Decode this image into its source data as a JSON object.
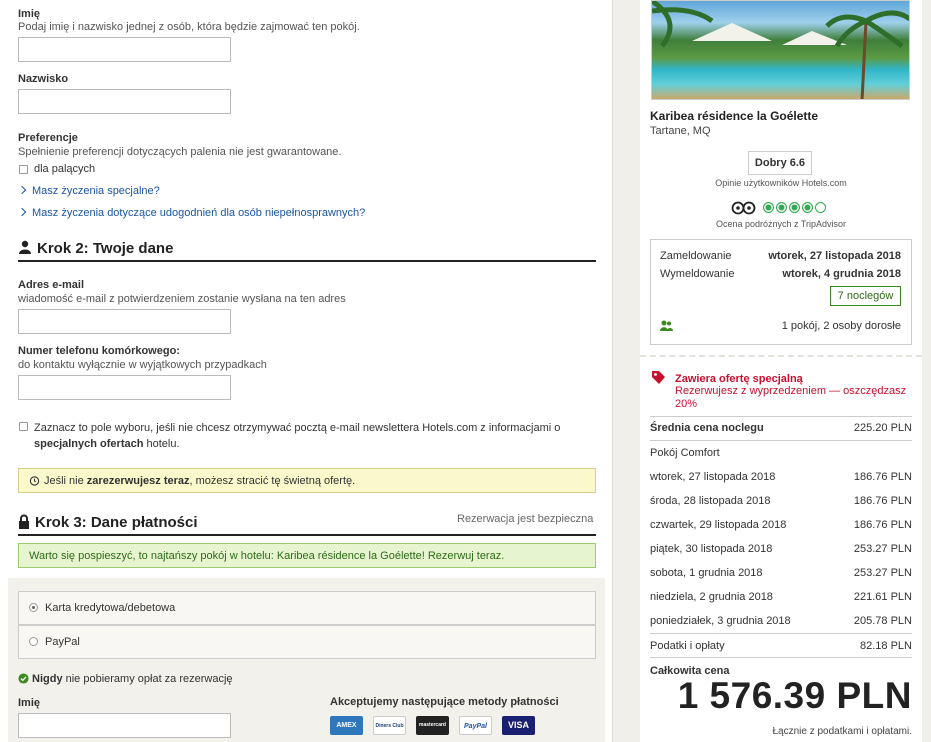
{
  "form": {
    "first_name_label": "Imię",
    "first_name_hint": "Podaj imię i nazwisko jednej z osób, która będzie zajmować ten pokój.",
    "last_name_label": "Nazwisko",
    "pref_label": "Preferencje",
    "pref_hint": "Spełnienie preferencji dotyczących palenia nie jest gwarantowane.",
    "smoking_label": "dla palących",
    "special_link": "Masz życzenia specjalne?",
    "accessibility_link": "Masz życzenia dotyczące udogodnień dla osób niepełnosprawnych?",
    "step2_title": "Krok 2: Twoje dane",
    "email_label": "Adres e-mail",
    "email_hint": "wiadomość e-mail z potwierdzeniem zostanie wysłana na ten adres",
    "phone_label": "Numer telefonu komórkowego:",
    "phone_hint": "do kontaktu wyłącznie w wyjątkowych przypadkach",
    "newsletter_a": "Zaznacz to pole wyboru, jeśli nie chcesz otrzymywać pocztą e-mail newslettera Hotels.com z informacjami o",
    "newsletter_b_bold": "specjalnych ofertach",
    "newsletter_b_rest": " hotelu.",
    "alert_pre": "Jeśli nie ",
    "alert_bold": "zarezerwujesz teraz",
    "alert_post": ", możesz stracić tę świetną ofertę.",
    "step3_title": "Krok 3: Dane płatności",
    "secure_text": "Rezerwacja jest bezpieczna",
    "green_alert": "Warto się pospieszyć, to najtańszy pokój w hotelu: Karibea résidence la Goélette! Rezerwuj teraz.",
    "pay_card": "Karta kredytowa/debetowa",
    "pay_paypal": "PayPal",
    "never_bold": "Nigdy",
    "never_rest": " nie pobieramy opłat za rezerwację",
    "name_label": "Imię",
    "methods_label": "Akceptujemy następujące metody płatności",
    "cards": [
      "AMEX",
      "Diners Club",
      "mastercard",
      "PayPal",
      "VISA"
    ]
  },
  "hotel": {
    "name": "Karibea résidence la Goélette",
    "location": "Tartane, MQ",
    "rating": "Dobry 6.6",
    "rating_caption": "Opinie użytkowników Hotels.com",
    "ta_caption": "Ocena podróżnych z TripAdvisor",
    "ta_score": 4,
    "checkin_label": "Zameldowanie",
    "checkin_value": "wtorek, 27 listopada 2018",
    "checkout_label": "Wymeldowanie",
    "checkout_value": "wtorek, 4 grudnia 2018",
    "nights": "7 noclegów",
    "guests": "1 pokój, 2 osoby dorosłe",
    "offer_title": "Zawiera ofertę specjalną",
    "offer_desc": "Rezerwujesz z wyprzedzeniem — oszczędzasz 20%",
    "avg_label": "Średnia cena noclegu",
    "avg_value": "225.20 PLN",
    "room_type": "Pokój Comfort",
    "nights_list": [
      {
        "day": "wtorek, 27 listopada 2018",
        "price": "186.76 PLN"
      },
      {
        "day": "środa, 28 listopada 2018",
        "price": "186.76 PLN"
      },
      {
        "day": "czwartek, 29 listopada 2018",
        "price": "186.76 PLN"
      },
      {
        "day": "piątek, 30 listopada 2018",
        "price": "253.27 PLN"
      },
      {
        "day": "sobota, 1 grudnia 2018",
        "price": "253.27 PLN"
      },
      {
        "day": "niedziela, 2 grudnia 2018",
        "price": "221.61 PLN"
      },
      {
        "day": "poniedziałek, 3 grudnia 2018",
        "price": "205.78 PLN"
      }
    ],
    "taxes_label": "Podatki i opłaty",
    "taxes_value": "82.18 PLN",
    "total_label": "Całkowita cena",
    "total_value": "1 576.39 PLN",
    "total_note": "Łącznie z podatkami i opłatami."
  },
  "colors": {
    "link": "#1a56a5",
    "offer_red": "#c8102e",
    "green": "#3a8a1f",
    "ta_green": "#34a853"
  }
}
